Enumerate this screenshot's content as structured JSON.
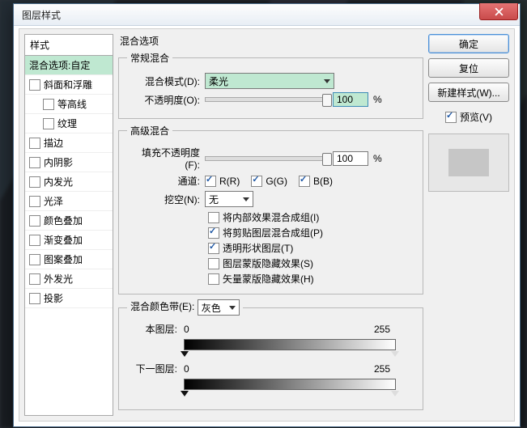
{
  "window": {
    "title": "图层样式"
  },
  "styles": {
    "header": "样式",
    "items": [
      {
        "label": "混合选项:自定",
        "checkable": false,
        "selected": true,
        "indent": false
      },
      {
        "label": "斜面和浮雕",
        "checkable": true,
        "selected": false,
        "indent": false
      },
      {
        "label": "等高线",
        "checkable": true,
        "selected": false,
        "indent": true
      },
      {
        "label": "纹理",
        "checkable": true,
        "selected": false,
        "indent": true
      },
      {
        "label": "描边",
        "checkable": true,
        "selected": false,
        "indent": false
      },
      {
        "label": "内阴影",
        "checkable": true,
        "selected": false,
        "indent": false
      },
      {
        "label": "内发光",
        "checkable": true,
        "selected": false,
        "indent": false
      },
      {
        "label": "光泽",
        "checkable": true,
        "selected": false,
        "indent": false
      },
      {
        "label": "颜色叠加",
        "checkable": true,
        "selected": false,
        "indent": false
      },
      {
        "label": "渐变叠加",
        "checkable": true,
        "selected": false,
        "indent": false
      },
      {
        "label": "图案叠加",
        "checkable": true,
        "selected": false,
        "indent": false
      },
      {
        "label": "外发光",
        "checkable": true,
        "selected": false,
        "indent": false
      },
      {
        "label": "投影",
        "checkable": true,
        "selected": false,
        "indent": false
      }
    ]
  },
  "main": {
    "heading": "混合选项",
    "general": {
      "legend": "常规混合",
      "blend_mode_label": "混合模式(D):",
      "blend_mode_value": "柔光",
      "opacity_label": "不透明度(O):",
      "opacity_value": "100",
      "opacity_suffix": "%"
    },
    "advanced": {
      "legend": "高级混合",
      "fill_label": "填充不透明度(F):",
      "fill_value": "100",
      "fill_suffix": "%",
      "channels_label": "通道:",
      "channel_r": "R(R)",
      "channel_g": "G(G)",
      "channel_b": "B(B)",
      "knockout_label": "挖空(N):",
      "knockout_value": "无",
      "opts": [
        {
          "label": "将内部效果混合成组(I)",
          "checked": false
        },
        {
          "label": "将剪贴图层混合成组(P)",
          "checked": true
        },
        {
          "label": "透明形状图层(T)",
          "checked": true
        },
        {
          "label": "图层蒙版隐藏效果(S)",
          "checked": false
        },
        {
          "label": "矢量蒙版隐藏效果(H)",
          "checked": false
        }
      ]
    },
    "blendif": {
      "legend_label": "混合颜色带(E):",
      "legend_value": "灰色",
      "this_label": "本图层:",
      "this_low": "0",
      "this_high": "255",
      "under_label": "下一图层:",
      "under_low": "0",
      "under_high": "255"
    }
  },
  "right": {
    "ok": "确定",
    "cancel": "复位",
    "new_style": "新建样式(W)...",
    "preview": "预览(V)"
  }
}
